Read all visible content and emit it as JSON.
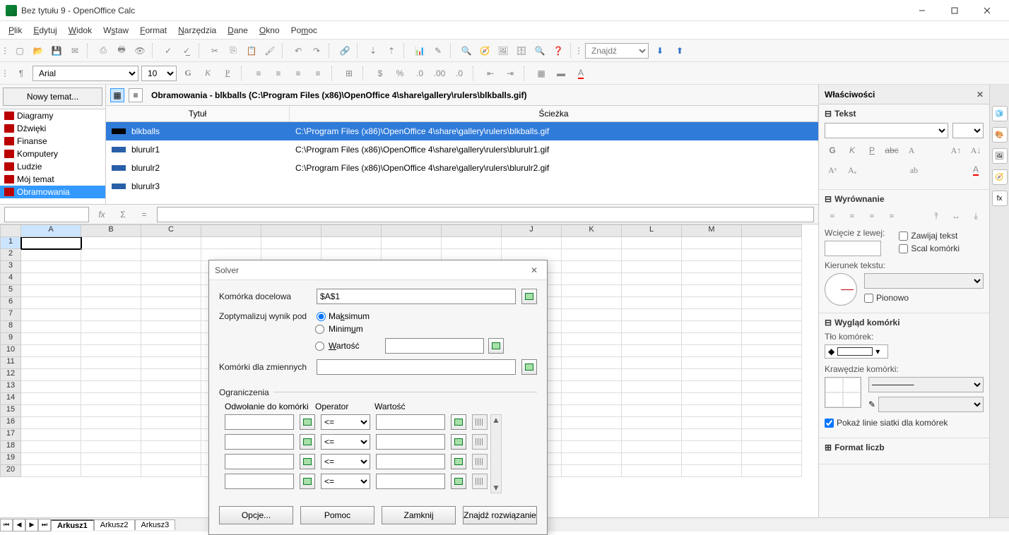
{
  "titlebar": {
    "title": "Bez tytułu 9 - OpenOffice Calc"
  },
  "menu": {
    "plik": "Plik",
    "edytuj": "Edytuj",
    "widok": "Widok",
    "wstaw": "Wstaw",
    "format": "Format",
    "narzedzia": "Narzędzia",
    "dane": "Dane",
    "okno": "Okno",
    "pomoc": "Pomoc"
  },
  "toolbar": {
    "find_placeholder": "Znajdź"
  },
  "format_toolbar": {
    "font": "Arial",
    "size": "10"
  },
  "gallery": {
    "new_theme": "Nowy temat...",
    "themes": [
      "Diagramy",
      "Dźwięki",
      "Finanse",
      "Komputery",
      "Ludzie",
      "Mój temat",
      "Obramowania"
    ],
    "selected_theme_index": 6,
    "path_label": "Obramowania - blkballs (C:\\Program Files (x86)\\OpenOffice 4\\share\\gallery\\rulers\\blkballs.gif)",
    "col_title": "Tytuł",
    "col_path": "Ścieżka",
    "rows": [
      {
        "title": "blkballs",
        "path": "C:\\Program Files (x86)\\OpenOffice 4\\share\\gallery\\rulers\\blkballs.gif"
      },
      {
        "title": "blurulr1",
        "path": "C:\\Program Files (x86)\\OpenOffice 4\\share\\gallery\\rulers\\blurulr1.gif"
      },
      {
        "title": "blurulr2",
        "path": "C:\\Program Files (x86)\\OpenOffice 4\\share\\gallery\\rulers\\blurulr2.gif"
      },
      {
        "title": "blurulr3",
        "path": ""
      }
    ]
  },
  "namebox": "",
  "columns": [
    "A",
    "B",
    "C",
    "",
    "",
    "",
    "",
    "",
    "J",
    "K",
    "L",
    "M"
  ],
  "rows": [
    1,
    2,
    3,
    4,
    5,
    6,
    7,
    8,
    9,
    10,
    11,
    12,
    13,
    14,
    15,
    16,
    17,
    18,
    19,
    20
  ],
  "sheet_tabs": [
    "Arkusz1",
    "Arkusz2",
    "Arkusz3"
  ],
  "solver": {
    "title": "Solver",
    "target_label": "Komórka docelowa",
    "target_value": "$A$1",
    "optimize_label": "Zoptymalizuj wynik pod",
    "opt_max": "Maksimum",
    "opt_min": "Minimum",
    "opt_val": "Wartość",
    "vars_label": "Komórki dla zmiennych",
    "constraints_label": "Ograniczenia",
    "col_ref": "Odwołanie do komórki",
    "col_op": "Operator",
    "col_val": "Wartość",
    "op_default": "<=",
    "btn_options": "Opcje...",
    "btn_help": "Pomoc",
    "btn_close": "Zamknij",
    "btn_solve": "Znajdź rozwiązanie"
  },
  "props": {
    "title": "Właściwości",
    "sec_text": "Tekst",
    "sec_align": "Wyrównanie",
    "indent_label": "Wcięcie z lewej:",
    "wrap_label": "Zawijaj tekst",
    "merge_label": "Scal komórki",
    "dir_label": "Kierunek tekstu:",
    "vert_label": "Pionowo",
    "sec_cell": "Wygląd komórki",
    "bg_label": "Tło komórek:",
    "border_label": "Krawędzie komórki:",
    "grid_label": "Pokaż linie siatki dla komórek",
    "sec_num": "Format liczb"
  }
}
